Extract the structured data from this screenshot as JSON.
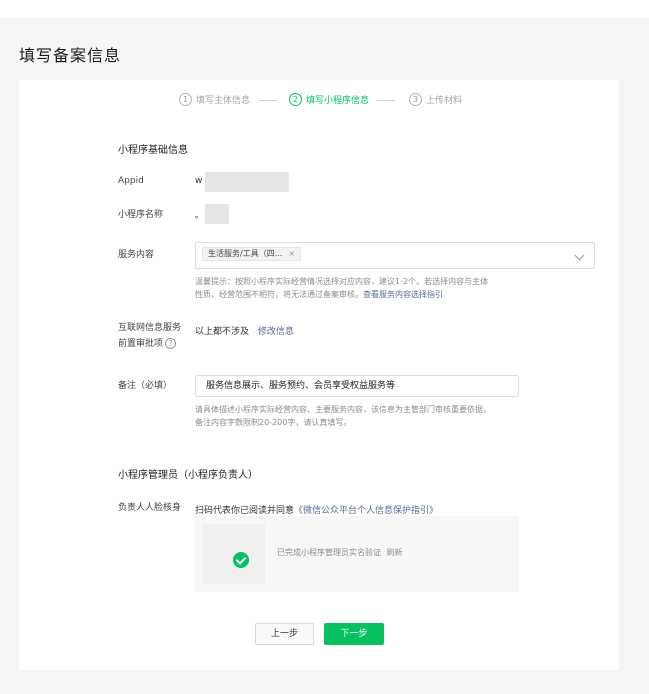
{
  "page": {
    "title": "填写备案信息"
  },
  "steps": [
    {
      "num": "1",
      "label": "填写主体信息",
      "state": "done"
    },
    {
      "num": "2",
      "label": "填写小程序信息",
      "state": "active"
    },
    {
      "num": "3",
      "label": "上传材料",
      "state": "todo"
    }
  ],
  "basic": {
    "title": "小程序基础信息",
    "appid_label": "Appid",
    "appid_value": "w",
    "name_label": "小程序名称",
    "name_value": "。",
    "service_label": "服务内容",
    "service_tag": "生活服务/工具（四...",
    "service_tag_close": "×",
    "hint_line1": "温馨提示：按照小程序实际经营情况选择对应内容，建议1-2个。若选择内容与主体",
    "hint_line2_prefix": "性质、经营范围不相符，将无法通过备案审核。",
    "hint_line2_link": "查看服务内容选择指引",
    "internet_label_line1": "互联网信息服务",
    "internet_label_line2": "前置审批项",
    "help_icon": "?",
    "internet_value": "以上都不涉及",
    "internet_edit": "修改信息",
    "remark_label": "备注（必填）",
    "remark_value": "服务信息展示、服务预约、会员享受权益服务等",
    "remark_hint_line1": "请具体描述小程序实际经营内容、主要服务内容，该信息为主管部门审核重要依据，",
    "remark_hint_line2": "备注内容字数限制20-200字，请认真填写。"
  },
  "admin": {
    "title": "小程序管理员（小程序负责人）",
    "face_label": "负责人人脸核身",
    "scan_prefix": "扫码代表你已阅读并同意",
    "scan_link": "《微信公众平台个人信息保护指引》",
    "status_text": "已完成小程序管理员实名验证",
    "refresh": "刷新"
  },
  "actions": {
    "prev": "上一步",
    "next": "下一步"
  },
  "colors": {
    "accent": "#07c160",
    "link": "#576b95"
  },
  "icons": {
    "check": "check-icon",
    "chevron": "chevron-down-icon",
    "help": "question-circle-icon"
  }
}
